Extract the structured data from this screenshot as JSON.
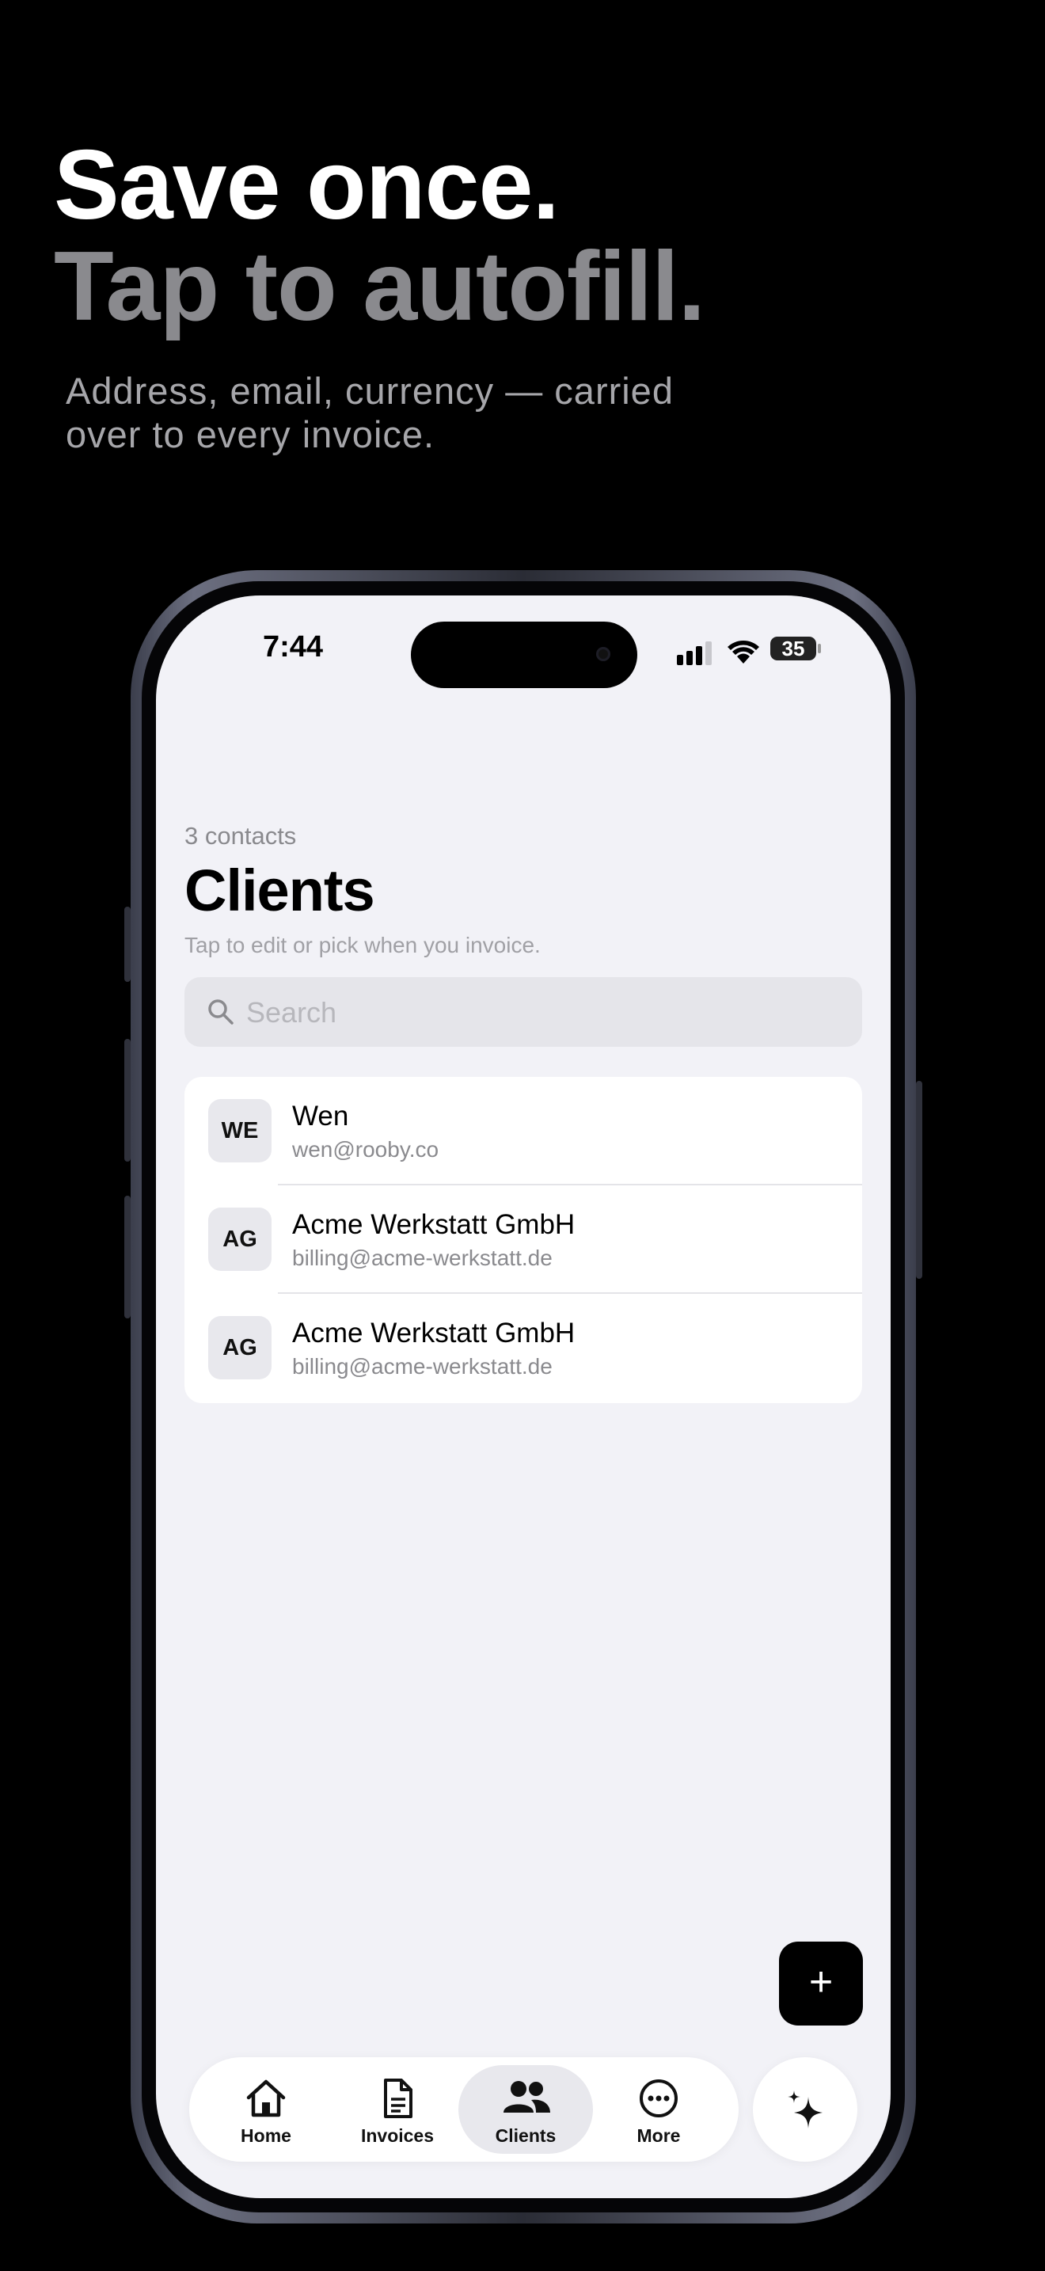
{
  "hero": {
    "line1": "Save once.",
    "line2": "Tap to autofill.",
    "subtitle_line1": "Address, email, currency — carried",
    "subtitle_line2": "over to every invoice."
  },
  "status_bar": {
    "time": "7:44",
    "battery": "35"
  },
  "clients_page": {
    "count_label": "3 contacts",
    "title": "Clients",
    "subtitle": "Tap to edit or pick when you invoice.",
    "search_placeholder": "Search",
    "clients": [
      {
        "initials": "WE",
        "name": "Wen",
        "email": "wen@rooby.co"
      },
      {
        "initials": "AG",
        "name": "Acme Werkstatt GmbH",
        "email": "billing@acme-werkstatt.de"
      },
      {
        "initials": "AG",
        "name": "Acme Werkstatt GmbH",
        "email": "billing@acme-werkstatt.de"
      }
    ],
    "add_button": "+"
  },
  "tabbar": {
    "tabs": [
      {
        "label": "Home",
        "icon": "house-icon",
        "active": false
      },
      {
        "label": "Invoices",
        "icon": "document-icon",
        "active": false
      },
      {
        "label": "Clients",
        "icon": "people-icon",
        "active": true
      },
      {
        "label": "More",
        "icon": "ellipsis-circle-icon",
        "active": false
      }
    ],
    "ai_button_icon": "sparkles-icon"
  },
  "colors": {
    "background": "#000000",
    "screen_bg": "#f2f2f7",
    "hero_primary": "#ffffff",
    "hero_secondary": "#8a8a8e",
    "accent": "#000000"
  }
}
